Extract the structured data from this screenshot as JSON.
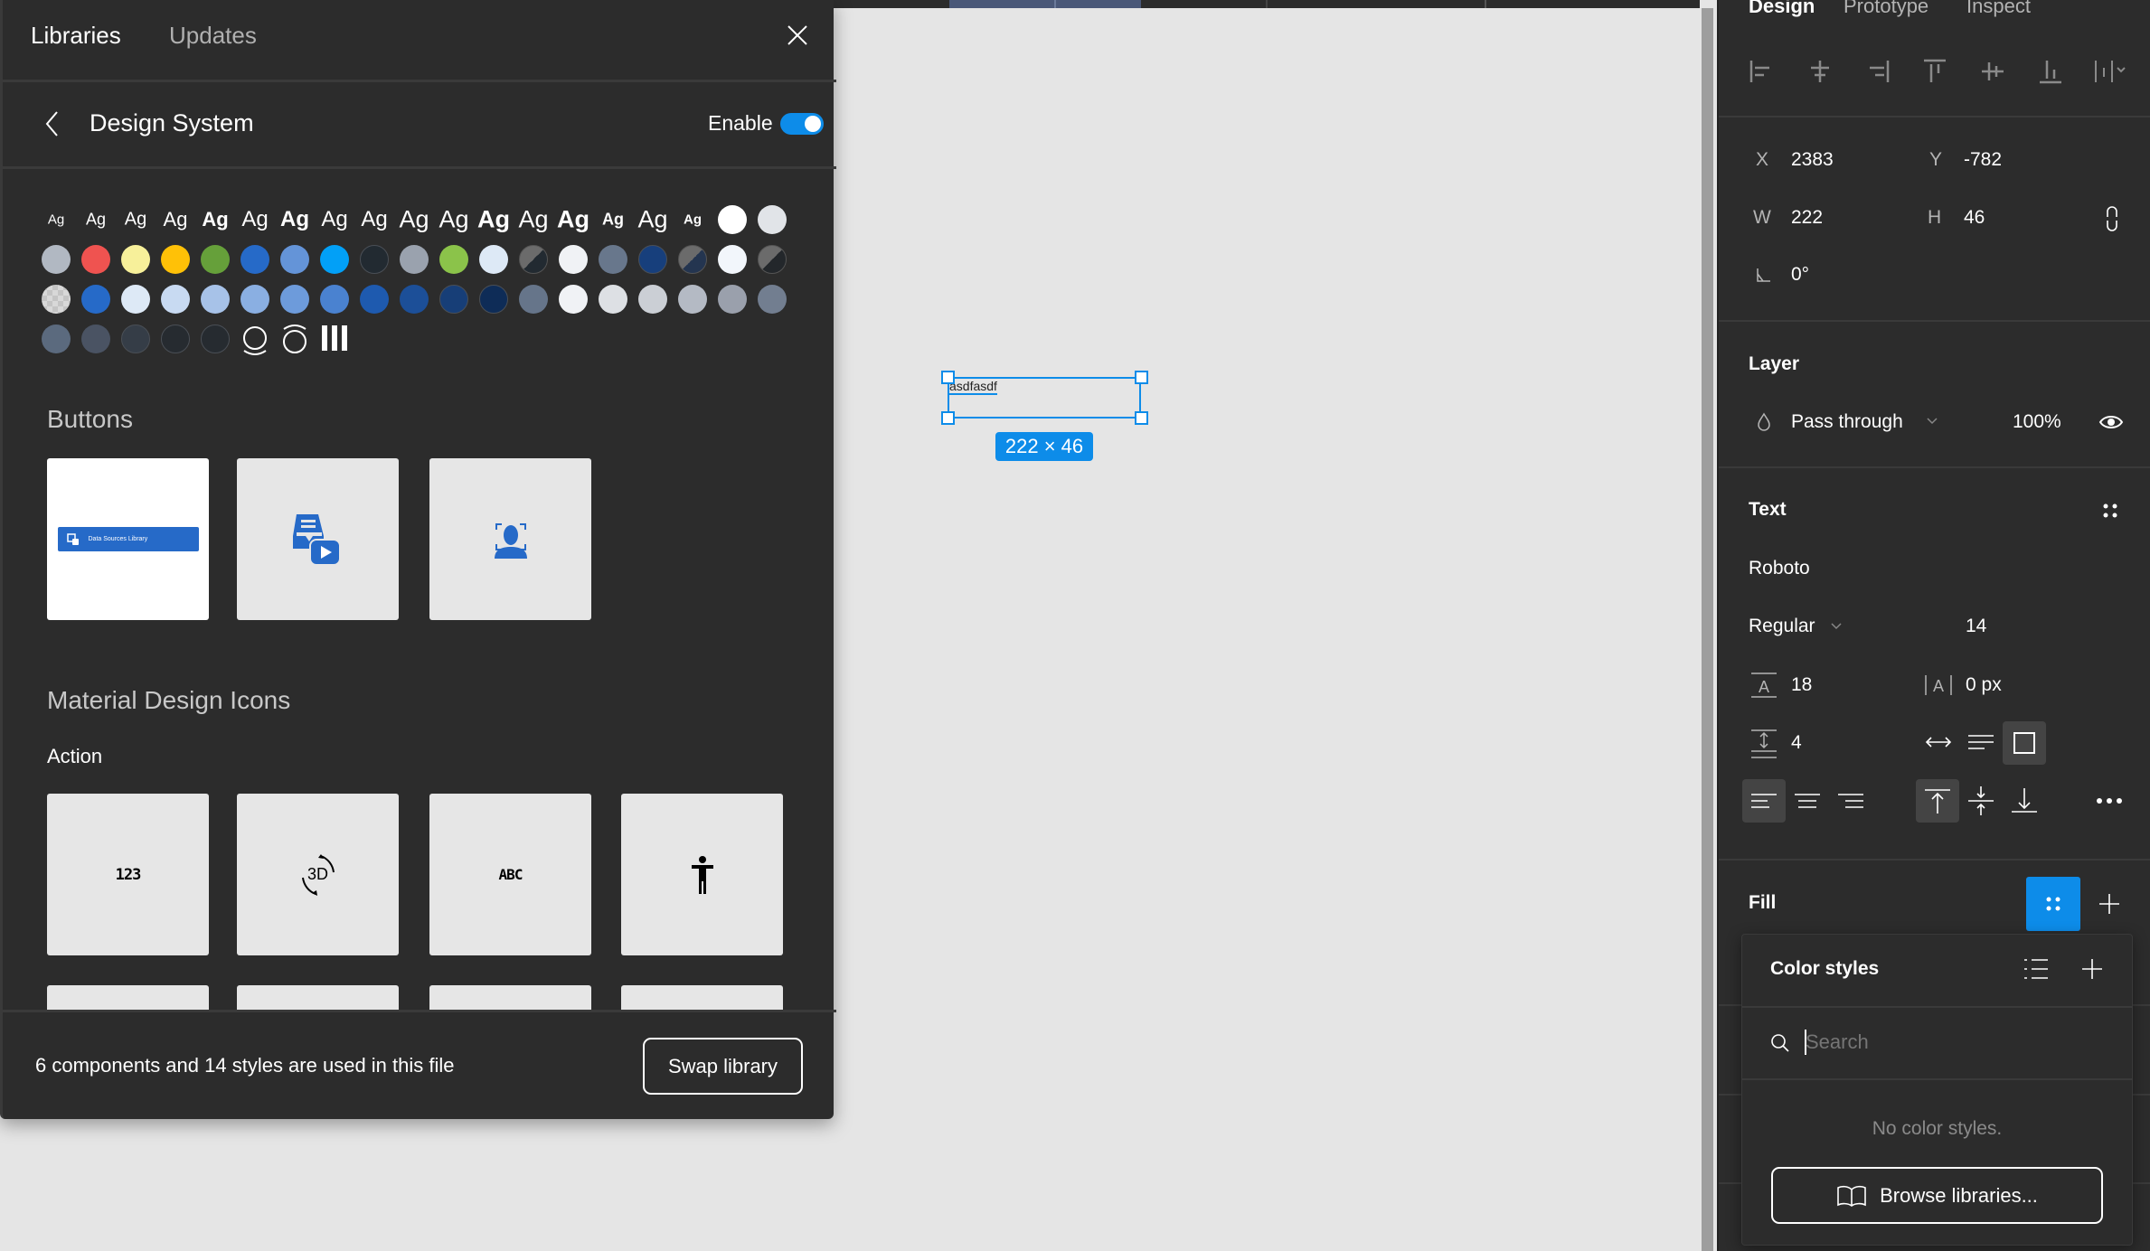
{
  "library_panel": {
    "tabs": [
      {
        "label": "Libraries",
        "active": true
      },
      {
        "label": "Updates",
        "active": false
      }
    ],
    "close_icon": "close-icon",
    "library_name": "Design System",
    "back_icon": "chevron-left-icon",
    "enable_label": "Enable",
    "enable_on": true,
    "text_styles_sample": "Ag",
    "text_styles": [
      {
        "size": 11,
        "weight": 400
      },
      {
        "size": 13,
        "weight": 500
      },
      {
        "size": 15,
        "weight": 400
      },
      {
        "size": 16,
        "weight": 500
      },
      {
        "size": 16,
        "weight": 700
      },
      {
        "size": 18,
        "weight": 400
      },
      {
        "size": 18,
        "weight": 700
      },
      {
        "size": 18,
        "weight": 500
      },
      {
        "size": 18,
        "weight": 400
      },
      {
        "size": 20,
        "weight": 500
      },
      {
        "size": 20,
        "weight": 500
      },
      {
        "size": 20,
        "weight": 700
      },
      {
        "size": 20,
        "weight": 400
      },
      {
        "size": 20,
        "weight": 700
      },
      {
        "size": 13,
        "weight": 700
      },
      {
        "size": 20,
        "weight": 400
      },
      {
        "size": 11,
        "weight": 700
      }
    ],
    "swatch_rows": [
      [
        "#ffffff",
        "#e1e4e8"
      ],
      [
        "#b1b8c2",
        "#ef5350",
        "#f7f09a",
        "#ffc107",
        "#66a03a",
        "#266ac8",
        "#6494d8",
        "#02a0f7",
        "#222a31",
        "#9aa2ae",
        "#8bc34a",
        "#dde9f6",
        "split:#222a31",
        "#f0f2f5",
        "#68778c",
        "#173f7c",
        "split:#243550",
        "#f2f6fb",
        "split:#23272b"
      ],
      [
        "checker:#d0d0d0",
        "#266ac8",
        "#dde9f6",
        "#c8daf2",
        "#a7c2e8",
        "#8aafe2",
        "#6d9bdb",
        "#4a82d0",
        "#1e5aaf",
        "#1c4f98",
        "#173e77",
        "#0e2c57",
        "#66758a",
        "#f0f2f5",
        "#dde0e4",
        "#cbcfd5",
        "#b4bac4",
        "#9aa0ac",
        "#727e90"
      ],
      [
        "#5b6a7e",
        "#4a5363",
        "#353d47",
        "#262b30",
        "#262b30"
      ]
    ],
    "effect_icons": [
      "shadow-bottom-icon",
      "shadow-top-icon",
      "grid-columns-icon"
    ],
    "buttons_heading": "Buttons",
    "buttons": [
      {
        "name": "data-sources-library-button",
        "label": "Data Sources Library",
        "bg": "white"
      },
      {
        "name": "inbox-play-icon",
        "bg": "gray"
      },
      {
        "name": "face-recognition-icon",
        "bg": "gray"
      }
    ],
    "mdi_heading": "Material Design Icons",
    "mdi_subheading": "Action",
    "mdi_icons": [
      {
        "name": "numeric-123-icon",
        "glyph": "123"
      },
      {
        "name": "3d-rotation-icon",
        "glyph": "3D"
      },
      {
        "name": "abc-icon",
        "glyph": "ABC"
      },
      {
        "name": "accessibility-icon",
        "glyph": ""
      }
    ],
    "footer_text": "6 components and 14 styles are used in this file",
    "swap_button": "Swap library"
  },
  "canvas": {
    "text_layer_content": "asdfasdf",
    "size_badge": "222 × 46",
    "accent": "#0d8ce9"
  },
  "design_panel": {
    "tabs": [
      {
        "label": "Design",
        "active": true
      },
      {
        "label": "Prototype",
        "active": false
      },
      {
        "label": "Inspect",
        "active": false
      }
    ],
    "align_icons": [
      "align-left-icon",
      "align-h-center-icon",
      "align-right-icon",
      "align-top-icon",
      "align-v-center-icon",
      "align-bottom-icon",
      "distribute-icon"
    ],
    "x_label": "X",
    "x": "2383",
    "y_label": "Y",
    "y": "-782",
    "w_label": "W",
    "w": "222",
    "h_label": "H",
    "h": "46",
    "rotation": "0°",
    "layer_heading": "Layer",
    "blend_mode": "Pass through",
    "opacity": "100%",
    "text_heading": "Text",
    "font_family": "Roboto",
    "font_weight": "Regular",
    "font_size": "14",
    "line_height": "18",
    "letter_spacing": "0 px",
    "paragraph_spacing": "4",
    "fill_heading": "Fill",
    "color_styles_popup": {
      "title": "Color styles",
      "search_placeholder": "Search",
      "empty_message": "No color styles.",
      "browse_button": "Browse libraries..."
    }
  }
}
